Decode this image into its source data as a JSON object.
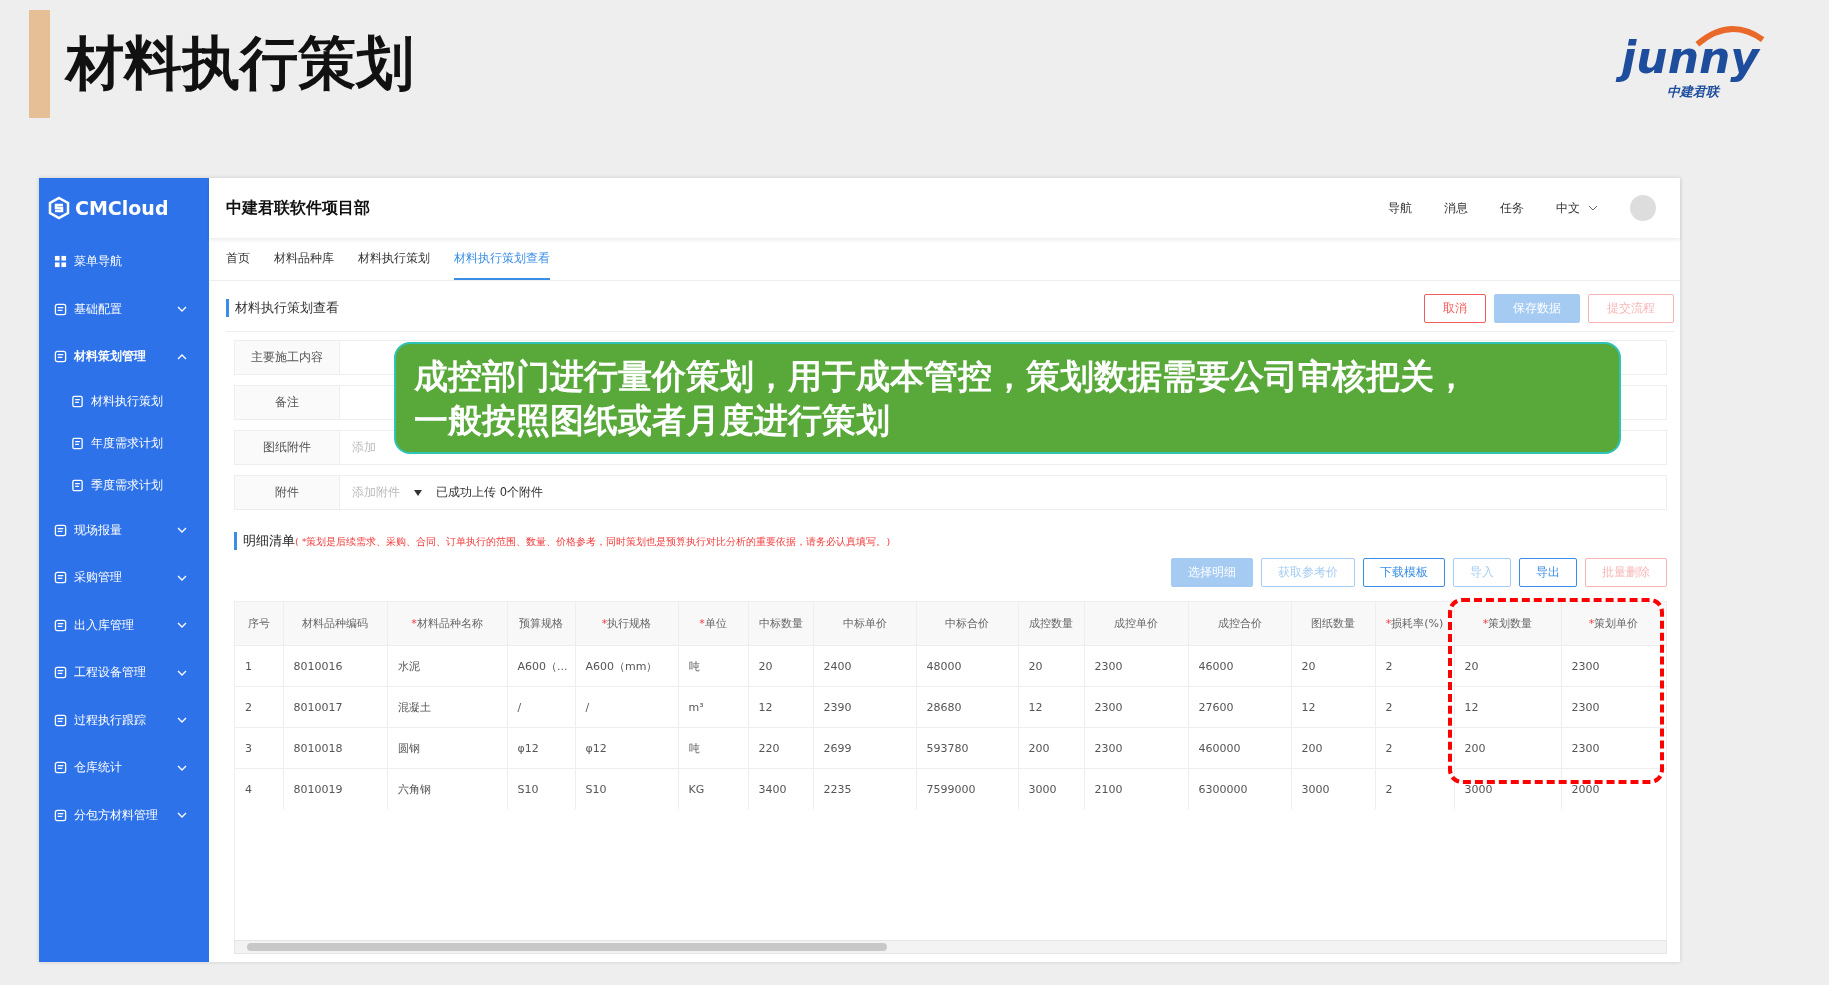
{
  "slide": {
    "title": "材料执行策划",
    "logo": {
      "wordmark": "junny",
      "subtitle": "中建君联"
    }
  },
  "sidebar": {
    "brand": "CMCloud",
    "items": [
      {
        "label": "菜单导航",
        "kind": "plain"
      },
      {
        "label": "基础配置",
        "kind": "group",
        "expanded": false
      },
      {
        "label": "材料策划管理",
        "kind": "group",
        "expanded": true,
        "children": [
          {
            "label": "材料执行策划"
          },
          {
            "label": "年度需求计划"
          },
          {
            "label": "季度需求计划"
          }
        ]
      },
      {
        "label": "现场报量",
        "kind": "group",
        "expanded": false
      },
      {
        "label": "采购管理",
        "kind": "group",
        "expanded": false
      },
      {
        "label": "出入库管理",
        "kind": "group",
        "expanded": false
      },
      {
        "label": "工程设备管理",
        "kind": "group",
        "expanded": false
      },
      {
        "label": "过程执行跟踪",
        "kind": "group",
        "expanded": false
      },
      {
        "label": "仓库统计",
        "kind": "group",
        "expanded": false
      },
      {
        "label": "分包方材料管理",
        "kind": "group",
        "expanded": false
      }
    ]
  },
  "header": {
    "project": "中建君联软件项目部",
    "nav": [
      "导航",
      "消息",
      "任务"
    ],
    "language": "中文"
  },
  "tabs": [
    {
      "label": "首页",
      "selected": false
    },
    {
      "label": "材料品种库",
      "selected": false
    },
    {
      "label": "材料执行策划",
      "selected": false
    },
    {
      "label": "材料执行策划查看",
      "selected": true
    }
  ],
  "page_title": "材料执行策划查看",
  "actions": [
    {
      "label": "取消",
      "kind": "danger",
      "disabled": false
    },
    {
      "label": "保存数据",
      "kind": "primary",
      "disabled": true
    },
    {
      "label": "提交流程",
      "kind": "danger",
      "disabled": true
    }
  ],
  "form": [
    {
      "label": "主要施工内容",
      "kind": "textarea"
    },
    {
      "label": "备注",
      "kind": "textarea"
    },
    {
      "label": "图纸附件",
      "kind": "upload",
      "placeholder": "添加"
    },
    {
      "label": "附件",
      "kind": "upload",
      "placeholder": "添加附件",
      "status": "已成功上传 0个附件"
    }
  ],
  "callout": {
    "lines": [
      "成控部门进行量价策划，用于成本管控，策划数据需要公司审核把关，",
      "一般按照图纸或者月度进行策划"
    ]
  },
  "detail": {
    "title": "明细清单",
    "note": "( *策划是后续需求、采购、合同、订单执行的范围、数量、价格参考，同时策划也是预算执行对比分析的重要依据，请务必认真填写。)",
    "buttons": [
      {
        "label": "选择明细",
        "kind": "primary",
        "disabled": true
      },
      {
        "label": "获取参考价",
        "kind": "outline",
        "disabled": true
      },
      {
        "label": "下载模板",
        "kind": "outline",
        "disabled": false
      },
      {
        "label": "导入",
        "kind": "outline",
        "disabled": true
      },
      {
        "label": "导出",
        "kind": "outline",
        "disabled": false
      },
      {
        "label": "批量删除",
        "kind": "danger",
        "disabled": true
      }
    ]
  },
  "table": {
    "columns": [
      {
        "label": "序号",
        "highlighted": false
      },
      {
        "label": "材料品种编码",
        "highlighted": false
      },
      {
        "label": "材料品种名称",
        "required_mark": "*",
        "highlighted": false
      },
      {
        "label": "预算规格",
        "highlighted": false
      },
      {
        "label": "执行规格",
        "required_mark": "*",
        "highlighted": false
      },
      {
        "label": "单位",
        "required_mark": "*",
        "highlighted": false
      },
      {
        "label": "中标数量",
        "highlighted": false
      },
      {
        "label": "中标单价",
        "highlighted": false
      },
      {
        "label": "中标合价",
        "highlighted": false
      },
      {
        "label": "成控数量",
        "highlighted": false
      },
      {
        "label": "成控单价",
        "highlighted": false
      },
      {
        "label": "成控合价",
        "highlighted": false
      },
      {
        "label": "图纸数量",
        "highlighted": false
      },
      {
        "label": "损耗率(%)",
        "required_mark": "*",
        "highlighted": false
      },
      {
        "label": "策划数量",
        "required_mark": "*",
        "highlighted": true
      },
      {
        "label": "策划单价",
        "required_mark": "*",
        "highlighted": true
      }
    ],
    "rows": [
      [
        "1",
        "8010016",
        "水泥",
        "A600（...",
        "A600（mm）",
        "吨",
        "20",
        "2400",
        "48000",
        "20",
        "2300",
        "46000",
        "20",
        "2",
        "20",
        "2300"
      ],
      [
        "2",
        "8010017",
        "混凝土",
        "/",
        "/",
        "m³",
        "12",
        "2390",
        "28680",
        "12",
        "2300",
        "27600",
        "12",
        "2",
        "12",
        "2300"
      ],
      [
        "3",
        "8010018",
        "圆钢",
        "φ12",
        "φ12",
        "吨",
        "220",
        "2699",
        "593780",
        "200",
        "2300",
        "460000",
        "200",
        "2",
        "200",
        "2300"
      ],
      [
        "4",
        "8010019",
        "六角钢",
        "S10",
        "S10",
        "KG",
        "3400",
        "2235",
        "7599000",
        "3000",
        "2100",
        "6300000",
        "3000",
        "2",
        "3000",
        "2000"
      ]
    ]
  }
}
